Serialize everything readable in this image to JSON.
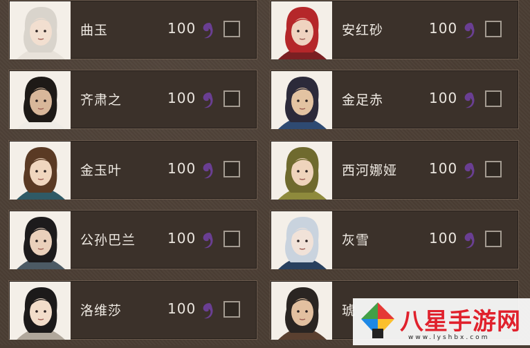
{
  "characters": [
    {
      "name": "曲玉",
      "cost": "100",
      "hair": "#d9d4cc",
      "skin": "#f2dfd0",
      "cloth": "#e8e2da"
    },
    {
      "name": "安红砂",
      "cost": "100",
      "hair": "#b5272a",
      "skin": "#efd3c0",
      "cloth": "#7a1f22"
    },
    {
      "name": "齐肃之",
      "cost": "100",
      "hair": "#1e1a17",
      "skin": "#d8b79a",
      "cloth": "#efece6"
    },
    {
      "name": "金足赤",
      "cost": "100",
      "hair": "#2c2a3a",
      "skin": "#e3c3a2",
      "cloth": "#2e4a72"
    },
    {
      "name": "金玉叶",
      "cost": "100",
      "hair": "#5a3a24",
      "skin": "#f0d6bf",
      "cloth": "#2f5a66"
    },
    {
      "name": "西河娜娅",
      "cost": "100",
      "hair": "#6f6a2e",
      "skin": "#efd4bc",
      "cloth": "#8e8a3c"
    },
    {
      "name": "公孙巴兰",
      "cost": "100",
      "hair": "#1d1b1c",
      "skin": "#ead0bb",
      "cloth": "#4c5a64"
    },
    {
      "name": "灰雪",
      "cost": "100",
      "hair": "#c9d3de",
      "skin": "#f1e2d8",
      "cloth": "#28405e"
    },
    {
      "name": "洛维莎",
      "cost": "100",
      "hair": "#1c1a1a",
      "skin": "#f2ddca",
      "cloth": "#b0a79b"
    },
    {
      "name": "琥",
      "cost": "",
      "hair": "#2a2522",
      "skin": "#e2c0a0",
      "cloth": "#5a4030"
    }
  ],
  "currency_icon": "purple-swirl-icon",
  "currency_color": "#6a3f93",
  "watermark": {
    "text": "八星手游网",
    "url": "www.lyshbx.com",
    "color": "#e0212c"
  }
}
